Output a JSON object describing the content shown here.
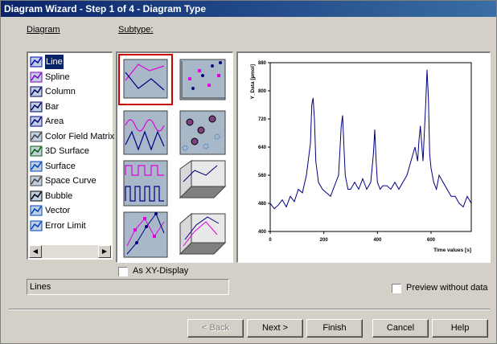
{
  "window": {
    "title": "Diagram Wizard - Step 1 of 4 - Diagram Type"
  },
  "labels": {
    "diagram": "Diagram",
    "subtype": "Subtype:"
  },
  "diagram_list": [
    {
      "label": "Line",
      "icon": "line-chart-icon",
      "selected": true
    },
    {
      "label": "Spline",
      "icon": "spline-chart-icon"
    },
    {
      "label": "Column",
      "icon": "column-chart-icon"
    },
    {
      "label": "Bar",
      "icon": "bar-chart-icon"
    },
    {
      "label": "Area",
      "icon": "area-chart-icon"
    },
    {
      "label": "Color Field Matrix",
      "icon": "color-field-matrix-icon"
    },
    {
      "label": "3D Surface",
      "icon": "3d-surface-icon"
    },
    {
      "label": "Surface",
      "icon": "surface-icon"
    },
    {
      "label": "Space Curve",
      "icon": "space-curve-icon"
    },
    {
      "label": "Bubble",
      "icon": "bubble-chart-icon"
    },
    {
      "label": "Vector",
      "icon": "vector-chart-icon"
    },
    {
      "label": "Error Limit",
      "icon": "error-limit-icon"
    }
  ],
  "as_xy_display": {
    "label": "As XY-Display",
    "checked": false
  },
  "status_text": "Lines",
  "preview_without_data": {
    "label": "Preview without data",
    "checked": false
  },
  "buttons": {
    "back": "< Back",
    "next": "Next >",
    "finish": "Finish",
    "cancel": "Cancel",
    "help": "Help"
  },
  "colors": {
    "title_start": "#0a246a",
    "title_end": "#3a6ea5",
    "series": "#000080",
    "selection": "#0a246a",
    "subtype_selected_border": "#cc0000",
    "magenta": "#e000e0"
  },
  "chart_data": {
    "type": "line",
    "xlabel": "Time values [s]",
    "ylabel": "Y_Data [µmol]",
    "xlim": [
      0,
      750
    ],
    "ylim": [
      400,
      880
    ],
    "xticks": [
      0,
      200,
      400,
      600
    ],
    "yticks": [
      400,
      480,
      560,
      640,
      720,
      800,
      880
    ],
    "series": [
      {
        "x": [
          0,
          15,
          30,
          45,
          60,
          75,
          90,
          105,
          120,
          135,
          150,
          155,
          160,
          165,
          170,
          180,
          195,
          210,
          225,
          240,
          255,
          265,
          270,
          275,
          280,
          290,
          300,
          315,
          330,
          345,
          360,
          375,
          385,
          390,
          395,
          400,
          410,
          420,
          435,
          450,
          465,
          480,
          495,
          510,
          525,
          540,
          550,
          555,
          560,
          570,
          580,
          585,
          590,
          595,
          600,
          610,
          620,
          630,
          645,
          660,
          675,
          690,
          705,
          720,
          735,
          750
        ],
        "y": [
          480,
          465,
          475,
          490,
          470,
          500,
          485,
          520,
          510,
          560,
          650,
          760,
          780,
          720,
          600,
          540,
          520,
          510,
          500,
          530,
          560,
          700,
          730,
          640,
          560,
          520,
          520,
          540,
          520,
          550,
          520,
          540,
          620,
          690,
          600,
          540,
          520,
          530,
          530,
          520,
          540,
          520,
          540,
          560,
          600,
          640,
          600,
          660,
          700,
          600,
          760,
          860,
          780,
          620,
          580,
          540,
          520,
          560,
          540,
          520,
          500,
          500,
          480,
          470,
          500,
          480
        ]
      }
    ]
  }
}
